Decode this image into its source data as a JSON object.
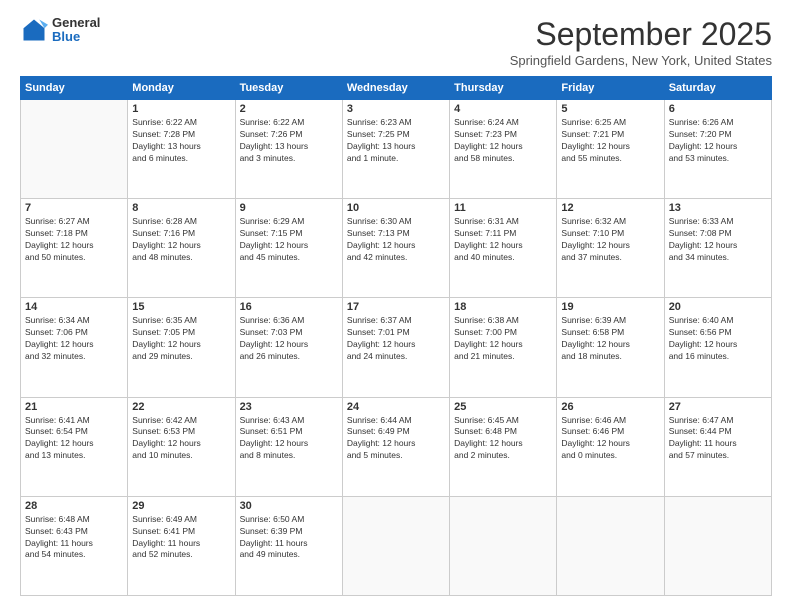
{
  "logo": {
    "general": "General",
    "blue": "Blue"
  },
  "header": {
    "month": "September 2025",
    "location": "Springfield Gardens, New York, United States"
  },
  "weekdays": [
    "Sunday",
    "Monday",
    "Tuesday",
    "Wednesday",
    "Thursday",
    "Friday",
    "Saturday"
  ],
  "weeks": [
    [
      {
        "day": "",
        "lines": []
      },
      {
        "day": "1",
        "lines": [
          "Sunrise: 6:22 AM",
          "Sunset: 7:28 PM",
          "Daylight: 13 hours",
          "and 6 minutes."
        ]
      },
      {
        "day": "2",
        "lines": [
          "Sunrise: 6:22 AM",
          "Sunset: 7:26 PM",
          "Daylight: 13 hours",
          "and 3 minutes."
        ]
      },
      {
        "day": "3",
        "lines": [
          "Sunrise: 6:23 AM",
          "Sunset: 7:25 PM",
          "Daylight: 13 hours",
          "and 1 minute."
        ]
      },
      {
        "day": "4",
        "lines": [
          "Sunrise: 6:24 AM",
          "Sunset: 7:23 PM",
          "Daylight: 12 hours",
          "and 58 minutes."
        ]
      },
      {
        "day": "5",
        "lines": [
          "Sunrise: 6:25 AM",
          "Sunset: 7:21 PM",
          "Daylight: 12 hours",
          "and 55 minutes."
        ]
      },
      {
        "day": "6",
        "lines": [
          "Sunrise: 6:26 AM",
          "Sunset: 7:20 PM",
          "Daylight: 12 hours",
          "and 53 minutes."
        ]
      }
    ],
    [
      {
        "day": "7",
        "lines": [
          "Sunrise: 6:27 AM",
          "Sunset: 7:18 PM",
          "Daylight: 12 hours",
          "and 50 minutes."
        ]
      },
      {
        "day": "8",
        "lines": [
          "Sunrise: 6:28 AM",
          "Sunset: 7:16 PM",
          "Daylight: 12 hours",
          "and 48 minutes."
        ]
      },
      {
        "day": "9",
        "lines": [
          "Sunrise: 6:29 AM",
          "Sunset: 7:15 PM",
          "Daylight: 12 hours",
          "and 45 minutes."
        ]
      },
      {
        "day": "10",
        "lines": [
          "Sunrise: 6:30 AM",
          "Sunset: 7:13 PM",
          "Daylight: 12 hours",
          "and 42 minutes."
        ]
      },
      {
        "day": "11",
        "lines": [
          "Sunrise: 6:31 AM",
          "Sunset: 7:11 PM",
          "Daylight: 12 hours",
          "and 40 minutes."
        ]
      },
      {
        "day": "12",
        "lines": [
          "Sunrise: 6:32 AM",
          "Sunset: 7:10 PM",
          "Daylight: 12 hours",
          "and 37 minutes."
        ]
      },
      {
        "day": "13",
        "lines": [
          "Sunrise: 6:33 AM",
          "Sunset: 7:08 PM",
          "Daylight: 12 hours",
          "and 34 minutes."
        ]
      }
    ],
    [
      {
        "day": "14",
        "lines": [
          "Sunrise: 6:34 AM",
          "Sunset: 7:06 PM",
          "Daylight: 12 hours",
          "and 32 minutes."
        ]
      },
      {
        "day": "15",
        "lines": [
          "Sunrise: 6:35 AM",
          "Sunset: 7:05 PM",
          "Daylight: 12 hours",
          "and 29 minutes."
        ]
      },
      {
        "day": "16",
        "lines": [
          "Sunrise: 6:36 AM",
          "Sunset: 7:03 PM",
          "Daylight: 12 hours",
          "and 26 minutes."
        ]
      },
      {
        "day": "17",
        "lines": [
          "Sunrise: 6:37 AM",
          "Sunset: 7:01 PM",
          "Daylight: 12 hours",
          "and 24 minutes."
        ]
      },
      {
        "day": "18",
        "lines": [
          "Sunrise: 6:38 AM",
          "Sunset: 7:00 PM",
          "Daylight: 12 hours",
          "and 21 minutes."
        ]
      },
      {
        "day": "19",
        "lines": [
          "Sunrise: 6:39 AM",
          "Sunset: 6:58 PM",
          "Daylight: 12 hours",
          "and 18 minutes."
        ]
      },
      {
        "day": "20",
        "lines": [
          "Sunrise: 6:40 AM",
          "Sunset: 6:56 PM",
          "Daylight: 12 hours",
          "and 16 minutes."
        ]
      }
    ],
    [
      {
        "day": "21",
        "lines": [
          "Sunrise: 6:41 AM",
          "Sunset: 6:54 PM",
          "Daylight: 12 hours",
          "and 13 minutes."
        ]
      },
      {
        "day": "22",
        "lines": [
          "Sunrise: 6:42 AM",
          "Sunset: 6:53 PM",
          "Daylight: 12 hours",
          "and 10 minutes."
        ]
      },
      {
        "day": "23",
        "lines": [
          "Sunrise: 6:43 AM",
          "Sunset: 6:51 PM",
          "Daylight: 12 hours",
          "and 8 minutes."
        ]
      },
      {
        "day": "24",
        "lines": [
          "Sunrise: 6:44 AM",
          "Sunset: 6:49 PM",
          "Daylight: 12 hours",
          "and 5 minutes."
        ]
      },
      {
        "day": "25",
        "lines": [
          "Sunrise: 6:45 AM",
          "Sunset: 6:48 PM",
          "Daylight: 12 hours",
          "and 2 minutes."
        ]
      },
      {
        "day": "26",
        "lines": [
          "Sunrise: 6:46 AM",
          "Sunset: 6:46 PM",
          "Daylight: 12 hours",
          "and 0 minutes."
        ]
      },
      {
        "day": "27",
        "lines": [
          "Sunrise: 6:47 AM",
          "Sunset: 6:44 PM",
          "Daylight: 11 hours",
          "and 57 minutes."
        ]
      }
    ],
    [
      {
        "day": "28",
        "lines": [
          "Sunrise: 6:48 AM",
          "Sunset: 6:43 PM",
          "Daylight: 11 hours",
          "and 54 minutes."
        ]
      },
      {
        "day": "29",
        "lines": [
          "Sunrise: 6:49 AM",
          "Sunset: 6:41 PM",
          "Daylight: 11 hours",
          "and 52 minutes."
        ]
      },
      {
        "day": "30",
        "lines": [
          "Sunrise: 6:50 AM",
          "Sunset: 6:39 PM",
          "Daylight: 11 hours",
          "and 49 minutes."
        ]
      },
      {
        "day": "",
        "lines": []
      },
      {
        "day": "",
        "lines": []
      },
      {
        "day": "",
        "lines": []
      },
      {
        "day": "",
        "lines": []
      }
    ]
  ]
}
